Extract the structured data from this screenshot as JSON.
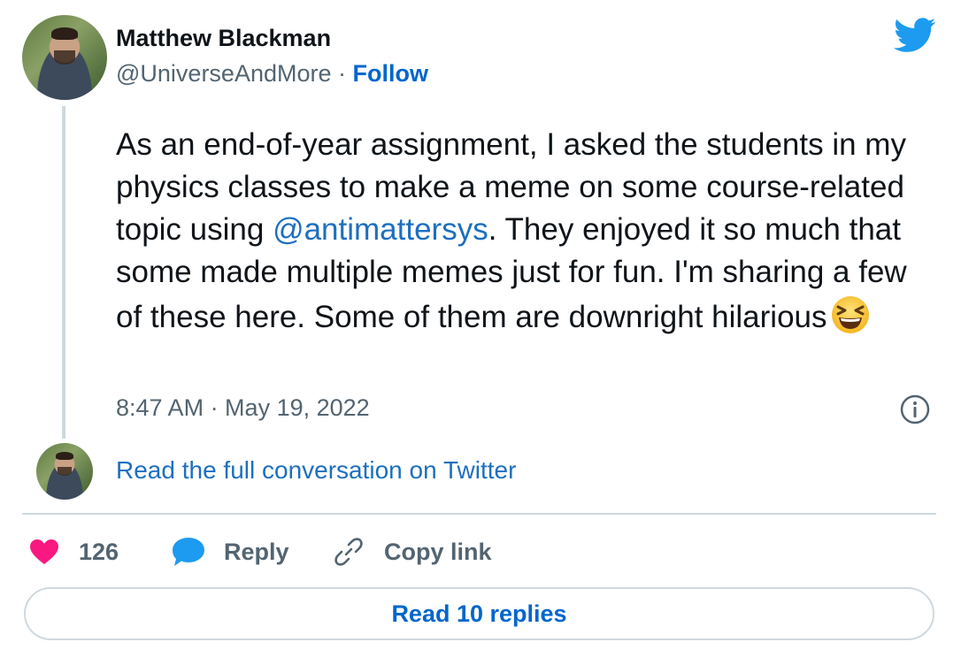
{
  "author": {
    "name": "Matthew Blackman",
    "handle": "@UniverseAndMore",
    "separator": " · ",
    "follow_label": "Follow"
  },
  "tweet": {
    "text_part1": "As an end-of-year assignment, I asked the students in my physics classes to make a meme on some course-related topic using ",
    "mention": "@antimattersys",
    "text_part2": ". They enjoyed it so much that some made multiple memes just for fun. I'm sharing a few of these here. Some of them are downright hilarious",
    "emoji": "laughing-face-emoji",
    "timestamp": "8:47 AM · May 19, 2022"
  },
  "conversation_link": "Read the full conversation on Twitter",
  "actions": {
    "like_count": "126",
    "reply_label": "Reply",
    "copy_link_label": "Copy link"
  },
  "read_replies_label": "Read 10 replies",
  "icons": {
    "brand": "twitter-bird-icon",
    "info": "info-icon",
    "like": "heart-icon",
    "reply": "speech-bubble-icon",
    "copy": "link-icon"
  },
  "colors": {
    "twitter_blue": "#1d9bf0",
    "link_blue": "#0066cc",
    "like_pink": "#f91880",
    "muted_text": "#536471",
    "border": "#cfd9de"
  }
}
